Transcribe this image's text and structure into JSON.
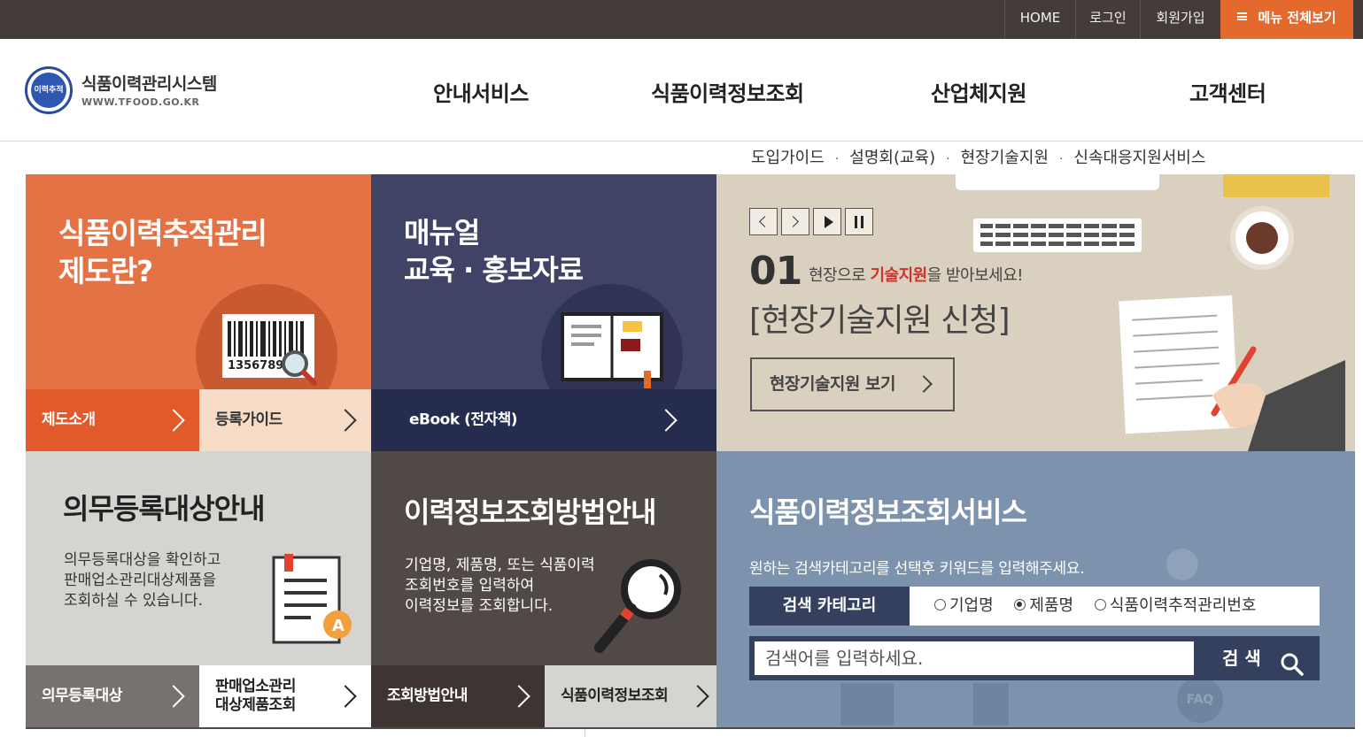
{
  "topbar": {
    "home": "HOME",
    "login": "로그인",
    "signup": "회원가입",
    "menu_all": "메뉴 전체보기"
  },
  "header": {
    "logo_title": "식품이력관리시스템",
    "logo_sub": "WWW.TFOOD.GO.KR",
    "logo_mark": "이력추적",
    "nav": [
      "안내서비스",
      "식품이력정보조회",
      "산업체지원",
      "고객센터"
    ],
    "subnav": [
      "도입가이드",
      "설명회(교육)",
      "현장기술지원",
      "신속대응지원서비스"
    ],
    "subnav_sep": "·"
  },
  "tiles": {
    "system_intro": {
      "title_line1": "식품이력추적관리",
      "title_line2": "제도란?",
      "barcode_number": "1356789",
      "btn1": "제도소개",
      "btn2": "등록가이드"
    },
    "manual": {
      "title_line1": "매뉴얼",
      "title_line2": "교육 · 홍보자료",
      "btn": "eBook (전자책)"
    },
    "banner": {
      "number": "01",
      "subtitle_pre": "현장으로 ",
      "subtitle_highlight": "기술지원",
      "subtitle_post": "을 받아보세요!",
      "headline": "[현장기술지원 신청]",
      "cta": "현장기술지원 보기"
    },
    "mandatory": {
      "title": "의무등록대상안내",
      "desc_line1": "의무등록대상을 확인하고",
      "desc_line2": "판매업소관리대상제품을",
      "desc_line3": "조회하실 수 있습니다.",
      "btn1": "의무등록대상",
      "btn2_line1": "판매업소관리",
      "btn2_line2": "대상제품조회"
    },
    "howto": {
      "title": "이력정보조회방법안내",
      "desc_line1": "기업명, 제품명, 또는 식품이력",
      "desc_line2": "조회번호를 입력하여",
      "desc_line3": "이력정보를 조회합니다.",
      "btn1": "조회방법안내",
      "btn2": "식품이력정보조회"
    },
    "search": {
      "title": "식품이력정보조회서비스",
      "desc": "원하는 검색카테고리를 선택후 키워드를 입력해주세요.",
      "category_label": "검색 카테고리",
      "options": [
        "기업명",
        "제품명",
        "식품이력추적관리번호"
      ],
      "selected": "제품명",
      "placeholder": "검색어를 입력하세요.",
      "button": "검 색",
      "bg_faq": "FAQ"
    }
  },
  "colors": {
    "topbar": "#433c39",
    "accent_orange": "#e36a2c",
    "tile_orange": "#e37345",
    "tile_navy": "#3f4466",
    "tile_brown": "#514946",
    "tile_grey": "#d5d4d1",
    "tile_blue": "#7d93ad",
    "banner_bg": "#d9d0bf"
  }
}
